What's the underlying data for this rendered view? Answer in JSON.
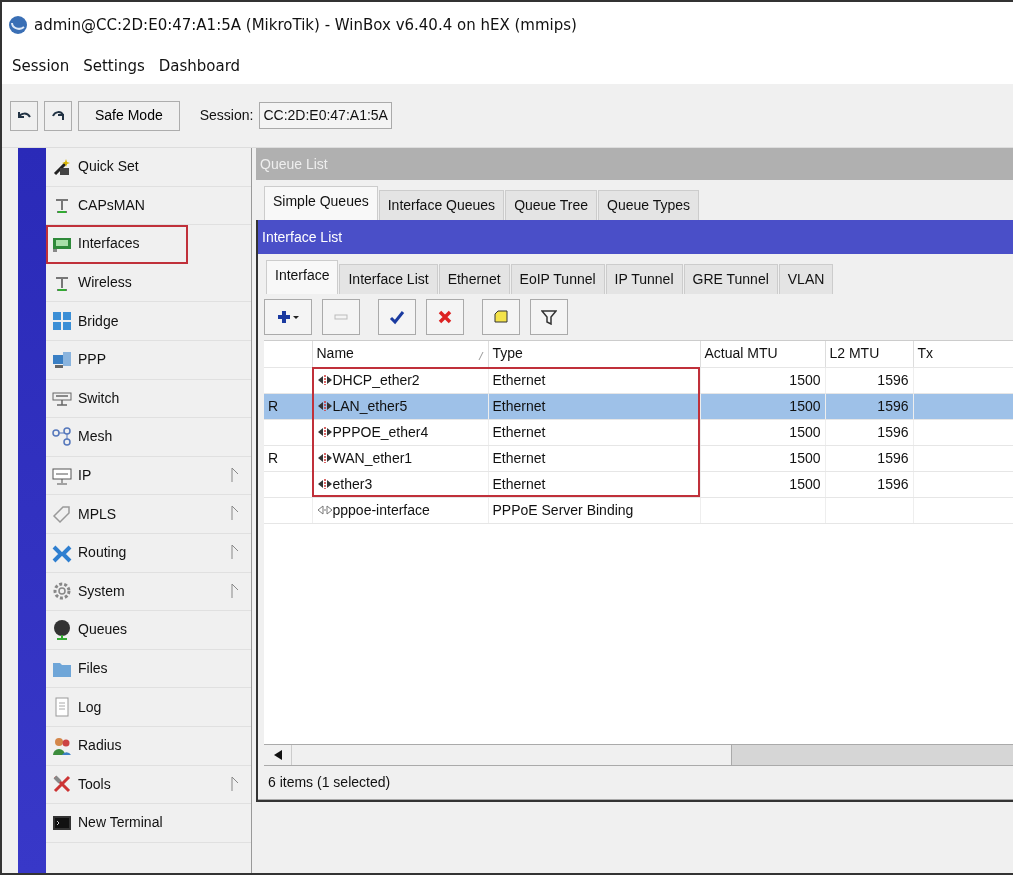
{
  "window": {
    "title": "admin@CC:2D:E0:47:A1:5A (MikroTik) - WinBox v6.40.4 on hEX (mmips)"
  },
  "menu": [
    "Session",
    "Settings",
    "Dashboard"
  ],
  "toolbar": {
    "safe_mode": "Safe Mode",
    "session_label": "Session:",
    "session_value": "CC:2D:E0:47:A1:5A"
  },
  "sidebar": {
    "items": [
      {
        "label": "Quick Set",
        "submenu": false,
        "highlighted": false
      },
      {
        "label": "CAPsMAN",
        "submenu": false,
        "highlighted": false
      },
      {
        "label": "Interfaces",
        "submenu": false,
        "highlighted": true
      },
      {
        "label": "Wireless",
        "submenu": false,
        "highlighted": false
      },
      {
        "label": "Bridge",
        "submenu": false,
        "highlighted": false
      },
      {
        "label": "PPP",
        "submenu": false,
        "highlighted": false
      },
      {
        "label": "Switch",
        "submenu": false,
        "highlighted": false
      },
      {
        "label": "Mesh",
        "submenu": false,
        "highlighted": false
      },
      {
        "label": "IP",
        "submenu": true,
        "highlighted": false
      },
      {
        "label": "MPLS",
        "submenu": true,
        "highlighted": false
      },
      {
        "label": "Routing",
        "submenu": true,
        "highlighted": false
      },
      {
        "label": "System",
        "submenu": true,
        "highlighted": false
      },
      {
        "label": "Queues",
        "submenu": false,
        "highlighted": false
      },
      {
        "label": "Files",
        "submenu": false,
        "highlighted": false
      },
      {
        "label": "Log",
        "submenu": false,
        "highlighted": false
      },
      {
        "label": "Radius",
        "submenu": false,
        "highlighted": false
      },
      {
        "label": "Tools",
        "submenu": true,
        "highlighted": false
      },
      {
        "label": "New Terminal",
        "submenu": false,
        "highlighted": false
      }
    ]
  },
  "queue_window": {
    "title": "Queue List",
    "tabs": [
      {
        "label": "Simple Queues",
        "selected": true
      },
      {
        "label": "Interface Queues",
        "selected": false
      },
      {
        "label": "Queue Tree",
        "selected": false
      },
      {
        "label": "Queue Types",
        "selected": false
      }
    ]
  },
  "interface_window": {
    "title": "Interface List",
    "tabs": [
      {
        "label": "Interface",
        "selected": true
      },
      {
        "label": "Interface List",
        "selected": false
      },
      {
        "label": "Ethernet",
        "selected": false
      },
      {
        "label": "EoIP Tunnel",
        "selected": false
      },
      {
        "label": "IP Tunnel",
        "selected": false
      },
      {
        "label": "GRE Tunnel",
        "selected": false
      },
      {
        "label": "VLAN",
        "selected": false
      }
    ],
    "table": {
      "columns": [
        "Name",
        "Type",
        "Actual MTU",
        "L2 MTU",
        "Tx"
      ],
      "rows": [
        {
          "flag": "",
          "name": "DHCP_ether2",
          "kind": "ethernet",
          "type": "Ethernet",
          "actual_mtu": "1500",
          "l2_mtu": "1596",
          "selected": false,
          "highlighted": true
        },
        {
          "flag": "R",
          "name": "LAN_ether5",
          "kind": "ethernet",
          "type": "Ethernet",
          "actual_mtu": "1500",
          "l2_mtu": "1596",
          "selected": true,
          "highlighted": true
        },
        {
          "flag": "",
          "name": "PPPOE_ether4",
          "kind": "ethernet",
          "type": "Ethernet",
          "actual_mtu": "1500",
          "l2_mtu": "1596",
          "selected": false,
          "highlighted": true
        },
        {
          "flag": "R",
          "name": "WAN_ether1",
          "kind": "ethernet",
          "type": "Ethernet",
          "actual_mtu": "1500",
          "l2_mtu": "1596",
          "selected": false,
          "highlighted": true
        },
        {
          "flag": "",
          "name": "ether3",
          "kind": "ethernet",
          "type": "Ethernet",
          "actual_mtu": "1500",
          "l2_mtu": "1596",
          "selected": false,
          "highlighted": true
        },
        {
          "flag": "",
          "name": "pppoe-interface",
          "kind": "binding",
          "type": "PPPoE Server Binding",
          "actual_mtu": "",
          "l2_mtu": "",
          "selected": false,
          "highlighted": false
        }
      ]
    },
    "status": "6 items (1 selected)"
  }
}
